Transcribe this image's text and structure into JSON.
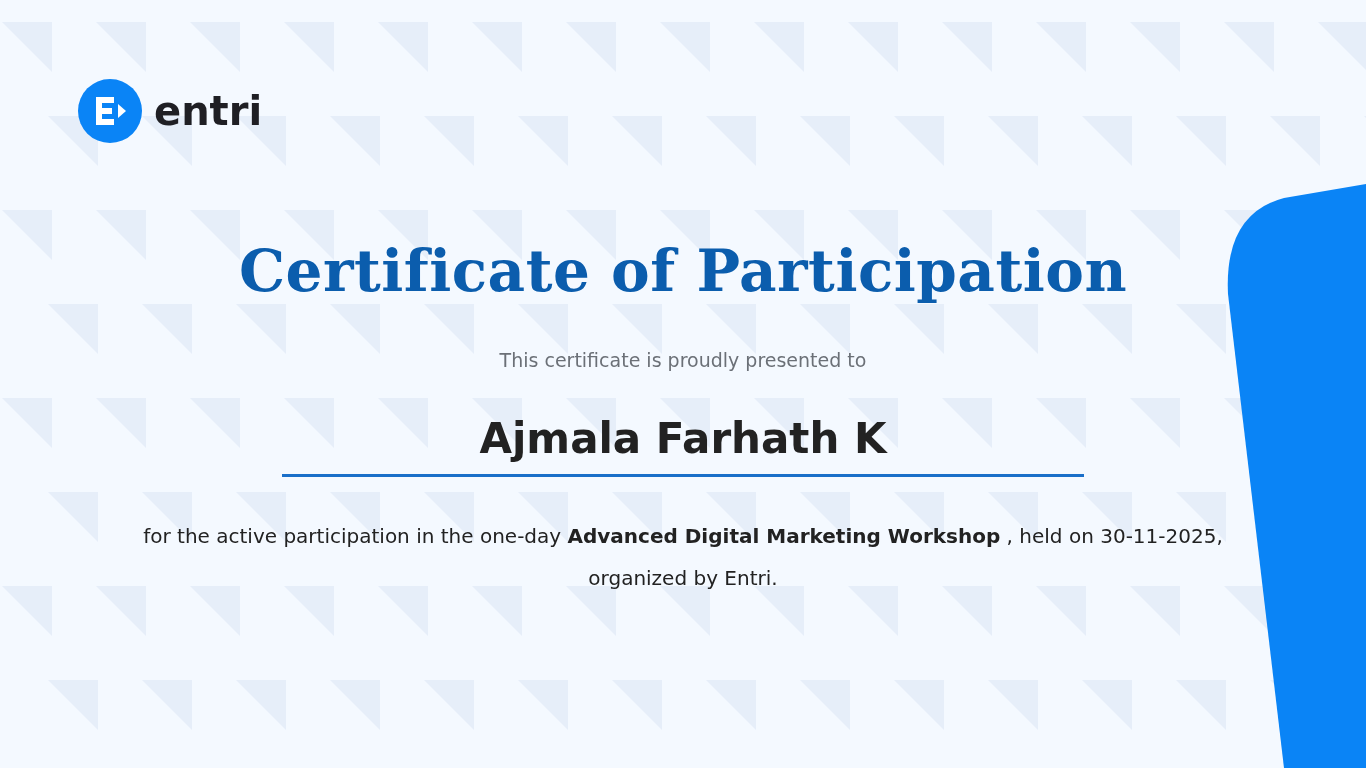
{
  "logo": {
    "wordmark": "entri"
  },
  "certificate": {
    "title": "Certificate of Participation",
    "subtitle": "This certificate is proudly presented to",
    "recipient": "Ajmala Farhath K",
    "description": "for the active participation in the one-day **Advanced Digital Marketing Workshop** , held on 30-11-2025, organized by Entri."
  }
}
